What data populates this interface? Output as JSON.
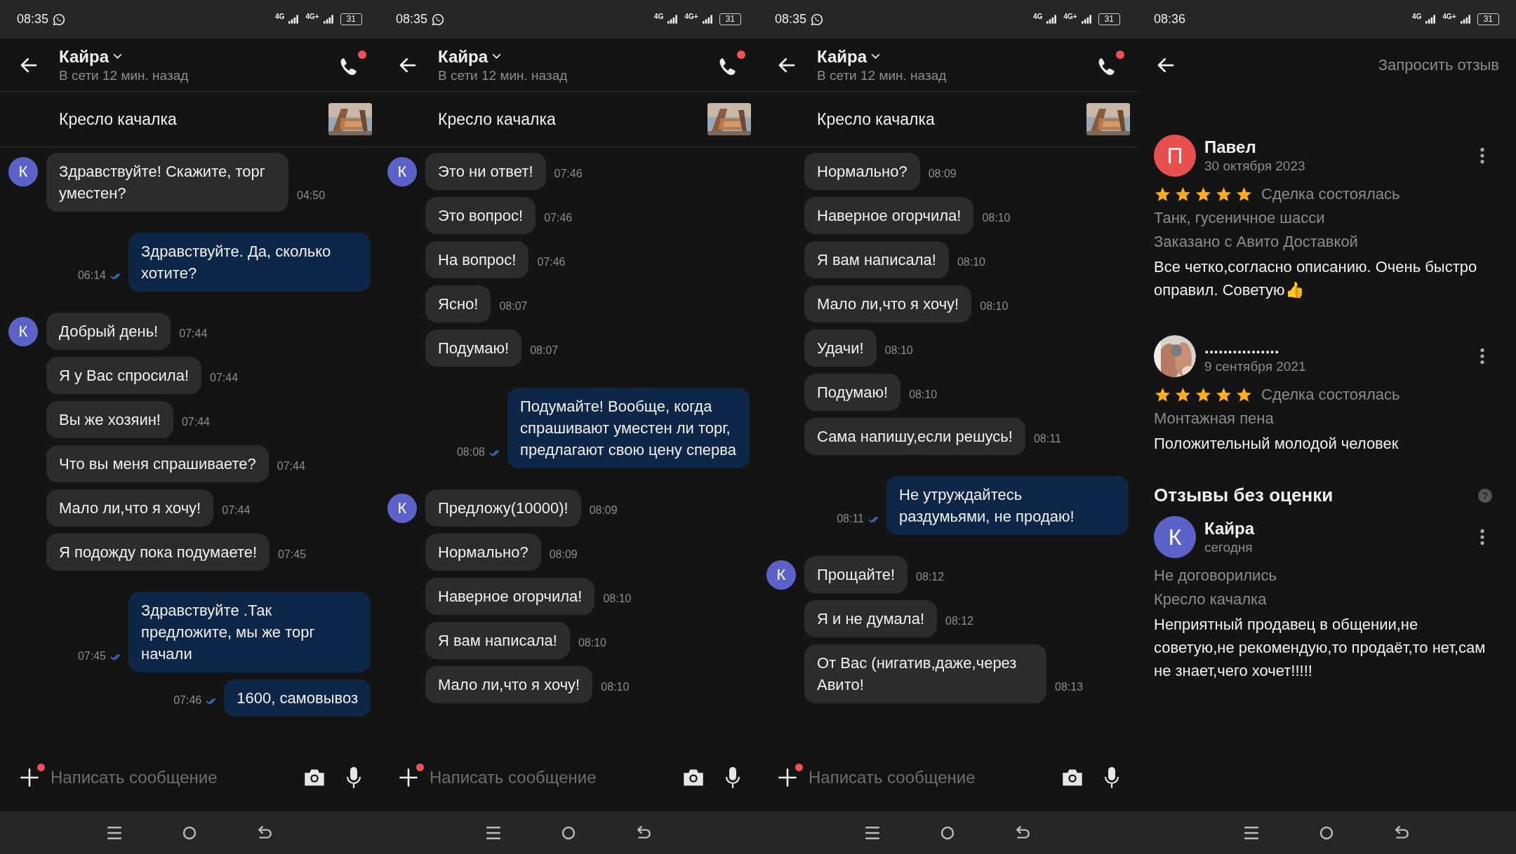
{
  "panels": [
    {
      "kind": "chat",
      "status_bar": {
        "time": "08:35",
        "chat_notification": true,
        "network": [
          "4G",
          "4G+"
        ],
        "battery": "31"
      },
      "header": {
        "name": "Кайра",
        "status": "В сети 12 мин. назад",
        "call_badge": true
      },
      "listing": {
        "title": "Кресло качалка"
      },
      "messages": [
        {
          "kind": "incoming",
          "avatar": "К",
          "text": "Здравствуйте! Скажите, торг уместен?",
          "time": "04:50"
        },
        {
          "kind": "outgoing",
          "text": "Здравствуйте. Да, сколько хотите?",
          "time": "06:14"
        },
        {
          "kind": "incoming",
          "avatar": "К",
          "text": "Добрый день!",
          "time": "07:44"
        },
        {
          "kind": "incoming",
          "text": "Я у Вас спросила!",
          "time": "07:44"
        },
        {
          "kind": "incoming",
          "text": "Вы же хозяин!",
          "time": "07:44"
        },
        {
          "kind": "incoming",
          "text": "Что вы меня спрашиваете?",
          "time": "07:44"
        },
        {
          "kind": "incoming",
          "text": "Мало ли,что я хочу!",
          "time": "07:44"
        },
        {
          "kind": "incoming",
          "text": "Я подожду пока подумаете!",
          "time": "07:45"
        },
        {
          "kind": "outgoing",
          "text": "Здравствуйте .Так предложите, мы же торг начали",
          "time": "07:45"
        },
        {
          "kind": "outgoing",
          "text": "1600, самовывоз",
          "time": "07:46"
        }
      ],
      "composer": {
        "placeholder": "Написать сообщение",
        "attach_badge": true
      }
    },
    {
      "kind": "chat",
      "status_bar": {
        "time": "08:35",
        "chat_notification": true,
        "network": [
          "4G",
          "4G+"
        ],
        "battery": "31"
      },
      "header": {
        "name": "Кайра",
        "status": "В сети 12 мин. назад",
        "call_badge": true
      },
      "listing": {
        "title": "Кресло качалка"
      },
      "messages": [
        {
          "kind": "incoming",
          "avatar": "К",
          "text": "Это ни ответ!",
          "time": "07:46"
        },
        {
          "kind": "incoming",
          "text": "Это вопрос!",
          "time": "07:46"
        },
        {
          "kind": "incoming",
          "text": "На вопрос!",
          "time": "07:46"
        },
        {
          "kind": "incoming",
          "text": "Ясно!",
          "time": "08:07"
        },
        {
          "kind": "incoming",
          "text": "Подумаю!",
          "time": "08:07"
        },
        {
          "kind": "outgoing",
          "text": "Подумайте! Вообще, когда спрашивают уместен ли торг, предлагают свою цену сперва",
          "time": "08:08"
        },
        {
          "kind": "incoming",
          "avatar": "К",
          "text": "Предложу(10000)!",
          "time": "08:09"
        },
        {
          "kind": "incoming",
          "text": "Нормально?",
          "time": "08:09"
        },
        {
          "kind": "incoming",
          "text": "Наверное огорчила!",
          "time": "08:10"
        },
        {
          "kind": "incoming",
          "text": "Я вам написала!",
          "time": "08:10"
        },
        {
          "kind": "incoming",
          "text": "Мало ли,что я хочу!",
          "time": "08:10"
        }
      ],
      "composer": {
        "placeholder": "Написать сообщение",
        "attach_badge": true
      }
    },
    {
      "kind": "chat",
      "status_bar": {
        "time": "08:35",
        "chat_notification": true,
        "network": [
          "4G",
          "4G+"
        ],
        "battery": "31"
      },
      "header": {
        "name": "Кайра",
        "status": "В сети 12 мин. назад",
        "call_badge": true
      },
      "listing": {
        "title": "Кресло качалка"
      },
      "messages": [
        {
          "kind": "incoming",
          "text": "Нормально?",
          "time": "08:09"
        },
        {
          "kind": "incoming",
          "text": "Наверное огорчила!",
          "time": "08:10"
        },
        {
          "kind": "incoming",
          "text": "Я вам написала!",
          "time": "08:10"
        },
        {
          "kind": "incoming",
          "text": "Мало ли,что я хочу!",
          "time": "08:10"
        },
        {
          "kind": "incoming",
          "text": "Удачи!",
          "time": "08:10"
        },
        {
          "kind": "incoming",
          "text": "Подумаю!",
          "time": "08:10"
        },
        {
          "kind": "incoming",
          "text": "Сама напишу,если решусь!",
          "time": "08:11"
        },
        {
          "kind": "outgoing",
          "text": "Не утруждайтесь раздумьями, не продаю!",
          "time": "08:11"
        },
        {
          "kind": "incoming",
          "avatar": "К",
          "text": "Прощайте!",
          "time": "08:12"
        },
        {
          "kind": "incoming",
          "text": "Я и не думала!",
          "time": "08:12"
        },
        {
          "kind": "incoming",
          "text": "От Вас (нигатив,даже,через Авито!",
          "time": "08:13"
        }
      ],
      "composer": {
        "placeholder": "Написать сообщение",
        "attach_badge": true
      }
    },
    {
      "kind": "reviews",
      "status_bar": {
        "time": "08:36",
        "chat_notification": false,
        "network": [
          "4G",
          "4G+"
        ],
        "battery": "31"
      },
      "header": {
        "action": "Запросить отзыв"
      },
      "reviews": [
        {
          "name": "Павел",
          "avatar": {
            "kind": "letter",
            "letter": "П",
            "color": "#e8504f"
          },
          "date": "30 октября 2023",
          "stars": 5,
          "outcome": "Сделка состоялась",
          "item": "Танк, гусеничное шасси",
          "delivery": "Заказано с Авито Доставкой",
          "text": "Все четко,согласно описанию. Очень быстро оправил. Советую👍"
        },
        {
          "name": "................",
          "date": "9 сентября 2021",
          "stars": 5,
          "outcome": "Сделка состоялась",
          "item": "Монтажная пена",
          "text": "Положительный молодой человек"
        }
      ],
      "unrated": {
        "title": "Отзывы без оценки",
        "help": "?",
        "reviews": [
          {
            "name": "Кайра",
            "avatar": {
              "kind": "letter",
              "letter": "К",
              "color": "#5b63c9"
            },
            "date": "сегодня",
            "outcome": "Не договорились",
            "item": "Кресло качалка",
            "text": "Неприятный продавец в общении,не советую,не рекомендую,то продаёт,то нет,сам не знает,чего хочет!!!!!"
          }
        ]
      }
    }
  ]
}
